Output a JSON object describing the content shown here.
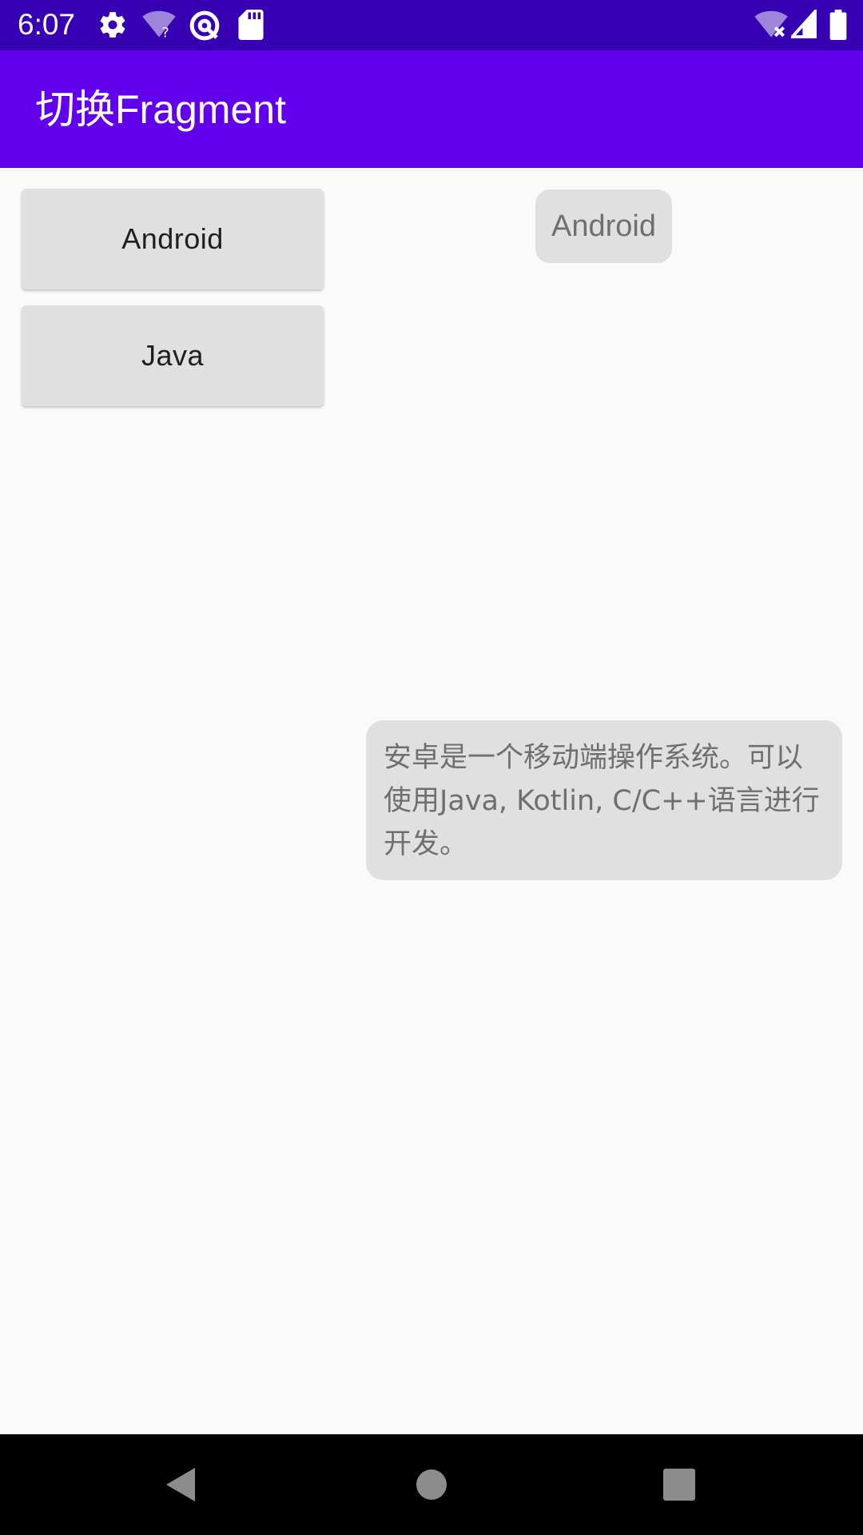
{
  "status_bar": {
    "time": "6:07",
    "icons": [
      "gear-icon",
      "wifi-question-icon",
      "at-sign-icon",
      "sd-card-icon",
      "wifi-off-icon",
      "cell-signal-icon",
      "battery-icon"
    ],
    "color": "#3700b3"
  },
  "app_bar": {
    "title": "切换Fragment",
    "color": "#6200ee"
  },
  "buttons": [
    {
      "label": "Android"
    },
    {
      "label": "Java"
    }
  ],
  "fragment": {
    "title": "Android",
    "description": "安卓是一个移动端操作系统。可以使用Java, Kotlin, C/C++语言进行开发。"
  },
  "nav_bar": {
    "icons": [
      "back-icon",
      "home-icon",
      "recents-icon"
    ]
  }
}
